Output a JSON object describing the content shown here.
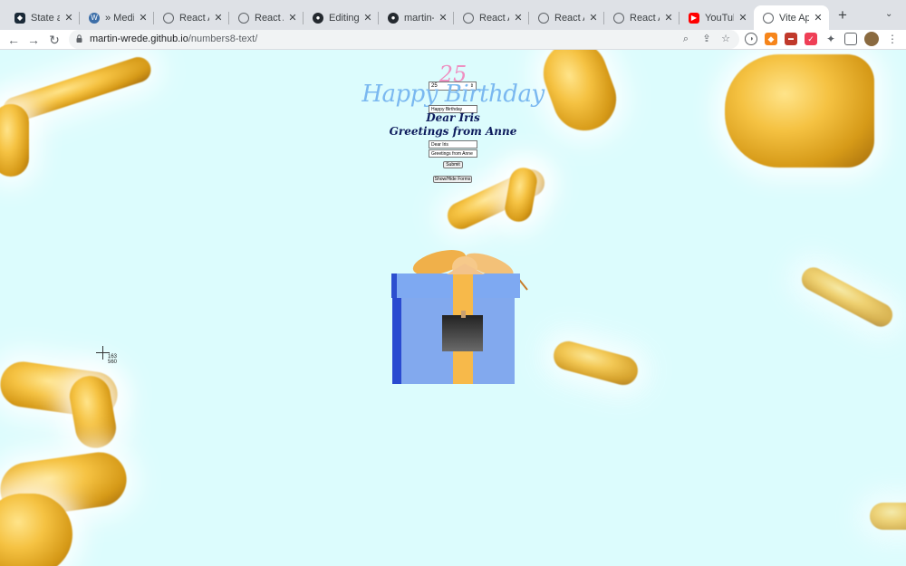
{
  "tabs": [
    {
      "title": "State and",
      "icon": "react-docs-icon",
      "color": "#1b2a38",
      "active": false
    },
    {
      "title": "» Media A",
      "icon": "wordpress-icon",
      "color": "#3c6ea8",
      "active": false
    },
    {
      "title": "React App",
      "icon": "globe-icon",
      "color": "#5f6368",
      "active": false
    },
    {
      "title": "React App",
      "icon": "globe-icon",
      "color": "#5f6368",
      "active": false
    },
    {
      "title": "Editing a",
      "icon": "github-icon",
      "color": "#24292f",
      "active": false
    },
    {
      "title": "martin-wr",
      "icon": "github-icon",
      "color": "#24292f",
      "active": false
    },
    {
      "title": "React App",
      "icon": "globe-icon",
      "color": "#5f6368",
      "active": false
    },
    {
      "title": "React App",
      "icon": "globe-icon",
      "color": "#5f6368",
      "active": false
    },
    {
      "title": "React App",
      "icon": "globe-icon",
      "color": "#5f6368",
      "active": false
    },
    {
      "title": "YouTube",
      "icon": "youtube-icon",
      "color": "#ff0000",
      "active": false
    },
    {
      "title": "Vite App",
      "icon": "globe-icon",
      "color": "#5f6368",
      "active": true
    }
  ],
  "toolbar": {
    "url_host": "martin-wrede.github.io",
    "url_path": "/numbers8-text/"
  },
  "page": {
    "age_number": "25",
    "age_input_value": "25",
    "headline": "Happy Birthday",
    "headline_input_value": "Happy Birthday",
    "dear_line": "Dear Iris",
    "greeting_line": "Greetings from Anne",
    "dear_input_value": "Dear Iris",
    "greeting_input_value": "Greetings from Anne",
    "submit_label": "Submit",
    "toggle_label": "Show/Hide Forms",
    "cursor_x": "163",
    "cursor_y": "560"
  },
  "colors": {
    "page_background": "#dcfcfd",
    "age_color": "#ee8fc1",
    "headline_color": "#7ab8f0",
    "message_color": "#0c1a5c",
    "gift_box_color": "#7aa8f0",
    "ribbon_color": "#f7b94a"
  }
}
